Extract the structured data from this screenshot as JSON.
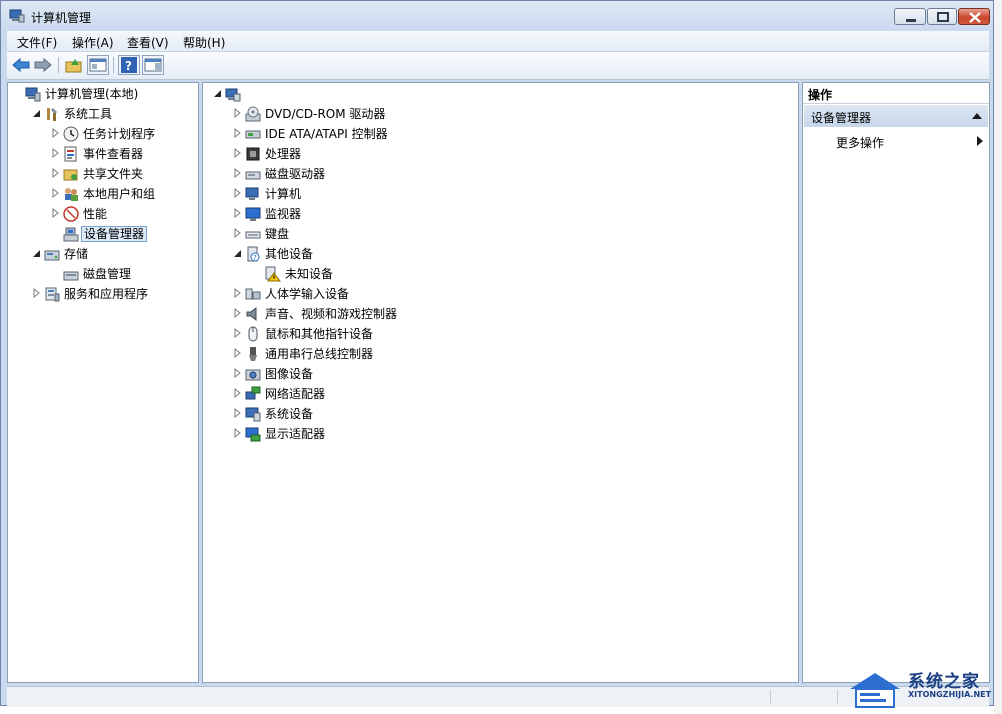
{
  "window": {
    "title": "计算机管理"
  },
  "menubar": [
    "文件(F)",
    "操作(A)",
    "查看(V)",
    "帮助(H)"
  ],
  "left_tree": [
    {
      "label": "计算机管理(本地)",
      "icon": "computer-management-icon",
      "level": 0,
      "toggle": "none"
    },
    {
      "label": "系统工具",
      "icon": "system-tools-icon",
      "level": 1,
      "toggle": "expanded"
    },
    {
      "label": "任务计划程序",
      "icon": "clock-icon",
      "level": 2,
      "toggle": "collapsed"
    },
    {
      "label": "事件查看器",
      "icon": "event-viewer-icon",
      "level": 2,
      "toggle": "collapsed"
    },
    {
      "label": "共享文件夹",
      "icon": "shared-folder-icon",
      "level": 2,
      "toggle": "collapsed"
    },
    {
      "label": "本地用户和组",
      "icon": "users-icon",
      "level": 2,
      "toggle": "collapsed"
    },
    {
      "label": "性能",
      "icon": "performance-icon",
      "level": 2,
      "toggle": "collapsed"
    },
    {
      "label": "设备管理器",
      "icon": "device-manager-icon",
      "level": 2,
      "toggle": "none",
      "selected": true
    },
    {
      "label": "存储",
      "icon": "storage-icon",
      "level": 1,
      "toggle": "expanded"
    },
    {
      "label": "磁盘管理",
      "icon": "disk-management-icon",
      "level": 2,
      "toggle": "none"
    },
    {
      "label": "服务和应用程序",
      "icon": "services-icon",
      "level": 1,
      "toggle": "collapsed"
    }
  ],
  "device_tree": {
    "root_label": "",
    "items": [
      {
        "label": "DVD/CD-ROM 驱动器",
        "icon": "dvd-drive-icon",
        "level": 1,
        "toggle": "collapsed"
      },
      {
        "label": "IDE ATA/ATAPI 控制器",
        "icon": "ide-controller-icon",
        "level": 1,
        "toggle": "collapsed"
      },
      {
        "label": "处理器",
        "icon": "processor-icon",
        "level": 1,
        "toggle": "collapsed"
      },
      {
        "label": "磁盘驱动器",
        "icon": "disk-drive-icon",
        "level": 1,
        "toggle": "collapsed"
      },
      {
        "label": "计算机",
        "icon": "computer-icon",
        "level": 1,
        "toggle": "collapsed"
      },
      {
        "label": "监视器",
        "icon": "monitor-icon",
        "level": 1,
        "toggle": "collapsed"
      },
      {
        "label": "键盘",
        "icon": "keyboard-icon",
        "level": 1,
        "toggle": "collapsed"
      },
      {
        "label": "其他设备",
        "icon": "other-devices-icon",
        "level": 1,
        "toggle": "expanded"
      },
      {
        "label": "未知设备",
        "icon": "warning-device-icon",
        "level": 2,
        "toggle": "none"
      },
      {
        "label": "人体学输入设备",
        "icon": "hid-icon",
        "level": 1,
        "toggle": "collapsed"
      },
      {
        "label": "声音、视频和游戏控制器",
        "icon": "speaker-icon",
        "level": 1,
        "toggle": "collapsed"
      },
      {
        "label": "鼠标和其他指针设备",
        "icon": "mouse-icon",
        "level": 1,
        "toggle": "collapsed"
      },
      {
        "label": "通用串行总线控制器",
        "icon": "usb-icon",
        "level": 1,
        "toggle": "collapsed"
      },
      {
        "label": "图像设备",
        "icon": "camera-icon",
        "level": 1,
        "toggle": "collapsed"
      },
      {
        "label": "网络适配器",
        "icon": "network-adapter-icon",
        "level": 1,
        "toggle": "collapsed"
      },
      {
        "label": "系统设备",
        "icon": "system-device-icon",
        "level": 1,
        "toggle": "collapsed"
      },
      {
        "label": "显示适配器",
        "icon": "display-adapter-icon",
        "level": 1,
        "toggle": "collapsed"
      }
    ]
  },
  "actions": {
    "header": "操作",
    "section": "设备管理器",
    "more": "更多操作"
  },
  "watermark": {
    "name": "系统之家",
    "url": "XITONGZHIJIA.NET"
  },
  "colors": {
    "frame": "#c9d9ee",
    "selection": "#dceaf9",
    "action_section": "#c7d6ea"
  }
}
